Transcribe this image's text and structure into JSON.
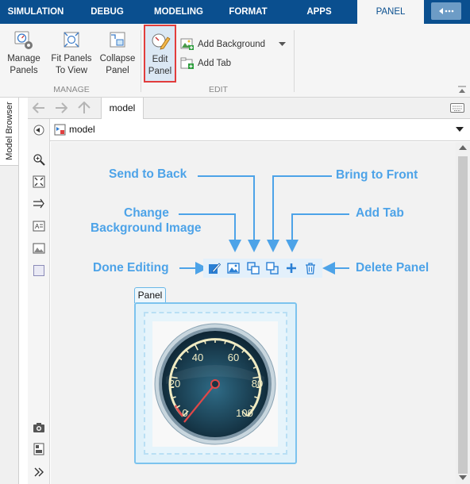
{
  "tabs": [
    "SIMULATION",
    "DEBUG",
    "MODELING",
    "FORMAT",
    "APPS",
    "PANEL"
  ],
  "ribbon": {
    "manage_panels": [
      "Manage",
      "Panels"
    ],
    "fit_panels": [
      "Fit Panels",
      "To View"
    ],
    "collapse_panel": [
      "Collapse",
      "Panel"
    ],
    "manage_group": "MANAGE",
    "edit_panel": [
      "Edit",
      "Panel"
    ],
    "add_background": "Add Background",
    "add_tab": "Add Tab",
    "edit_group": "EDIT"
  },
  "left_panel": {
    "label": "Model Browser"
  },
  "editor": {
    "model_tab": "model",
    "address": "model"
  },
  "annotations": {
    "send_to_back": "Send to Back",
    "bring_to_front": "Bring to Front",
    "change_bg_line1": "Change",
    "change_bg_line2": "Background Image",
    "add_tab": "Add Tab",
    "done_editing": "Done Editing",
    "delete_panel": "Delete Panel"
  },
  "panel": {
    "label": "Panel",
    "gauge_ticks": [
      "0",
      "20",
      "40",
      "60",
      "80",
      "100"
    ]
  },
  "colors": {
    "tabstrip": "#0a4f8f",
    "annotation": "#4da3e8",
    "highlight_border": "#e23d3d",
    "panel_border": "#7cc3ee"
  }
}
